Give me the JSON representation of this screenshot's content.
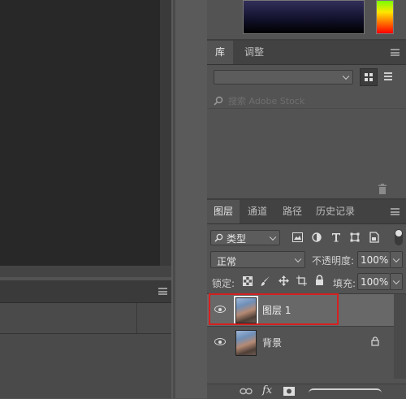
{
  "library_panel": {
    "tabs": [
      {
        "label": "库",
        "active": true
      },
      {
        "label": "调整",
        "active": false
      }
    ],
    "search_placeholder": "搜索 Adobe Stock"
  },
  "layers_panel": {
    "tabs": [
      {
        "label": "图层",
        "active": true
      },
      {
        "label": "通道",
        "active": false
      },
      {
        "label": "路径",
        "active": false
      },
      {
        "label": "历史记录",
        "active": false
      }
    ],
    "filter": {
      "label": "类型",
      "icons": [
        "image-filter-icon",
        "adjustment-filter-icon",
        "type-filter-icon",
        "shape-filter-icon",
        "smart-object-filter-icon"
      ]
    },
    "blend_mode": "正常",
    "opacity_label": "不透明度:",
    "opacity_value": "100%",
    "lock_label": "锁定:",
    "fill_label": "填充:",
    "fill_value": "100%",
    "layers": [
      {
        "name": "图层 1",
        "visible": true,
        "selected": true,
        "locked": false
      },
      {
        "name": "背景",
        "visible": true,
        "selected": false,
        "locked": true
      }
    ],
    "bottom_icons": [
      "link-layers-icon",
      "fx-icon",
      "layer-mask-icon"
    ],
    "fx_label": "fx"
  },
  "colors": {
    "highlight_border": "#d42020",
    "selected_row": "#686868",
    "panel_bg": "#535353"
  }
}
